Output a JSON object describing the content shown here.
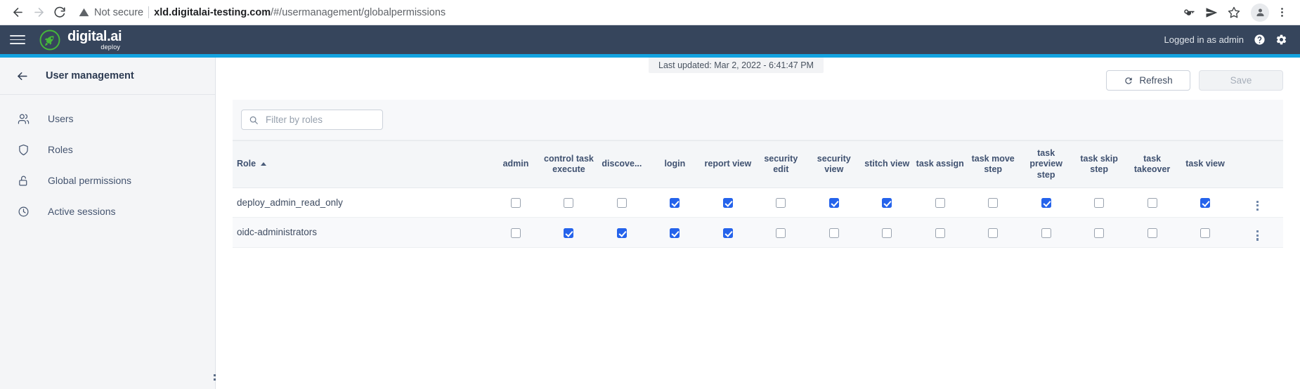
{
  "browser": {
    "back_icon": "back-arrow-icon",
    "forward_icon": "forward-arrow-icon",
    "reload_icon": "reload-icon",
    "security_icon": "warning-triangle-icon",
    "security_label": "Not secure",
    "url_host": "xld.digitalai-testing.com",
    "url_path": "/#/usermanagement/globalpermissions",
    "actions": [
      {
        "name": "password-key-icon"
      },
      {
        "name": "send-share-icon"
      },
      {
        "name": "bookmark-star-icon"
      },
      {
        "name": "profile-avatar-icon"
      },
      {
        "name": "browser-menu-icon"
      }
    ]
  },
  "app_header": {
    "menu_icon": "hamburger-menu-icon",
    "logo_icon": "rocket-logo-icon",
    "brand_name": "digital.ai",
    "brand_sub": "deploy",
    "logged_in_text": "Logged in as admin",
    "help_icon": "help-circle-icon",
    "settings_icon": "gear-icon",
    "background": "#36455c",
    "accent_color": "#13a3e0"
  },
  "sidebar": {
    "back_icon": "back-arrow-icon",
    "title": "User management",
    "items": [
      {
        "label": "Users",
        "icon": "people-icon"
      },
      {
        "label": "Roles",
        "icon": "shield-icon"
      },
      {
        "label": "Global permissions",
        "icon": "unlock-icon"
      },
      {
        "label": "Active sessions",
        "icon": "clock-icon"
      }
    ],
    "resize_handle": "sidebar-resize-handle"
  },
  "toolbar": {
    "last_updated": "Last updated: Mar 2, 2022 - 6:41:47 PM",
    "refresh_label": "Refresh",
    "refresh_icon": "refresh-icon",
    "save_label": "Save",
    "save_disabled": true
  },
  "filter": {
    "placeholder": "Filter by roles",
    "value": "",
    "icon": "search-icon"
  },
  "table": {
    "role_column_label": "Role",
    "sort_direction": "asc",
    "columns": [
      "admin",
      "control task execute",
      "discove...",
      "login",
      "report view",
      "security edit",
      "security view",
      "stitch view",
      "task assign",
      "task move step",
      "task preview step",
      "task skip step",
      "task takeover",
      "task view"
    ],
    "rows": [
      {
        "role": "deploy_admin_read_only",
        "permissions": [
          false,
          false,
          false,
          true,
          true,
          false,
          true,
          true,
          false,
          false,
          true,
          false,
          false,
          true
        ],
        "menu_icon": "row-menu-icon"
      },
      {
        "role": "oidc-administrators",
        "permissions": [
          false,
          true,
          true,
          true,
          true,
          false,
          false,
          false,
          false,
          false,
          false,
          false,
          false,
          false
        ],
        "menu_icon": "row-menu-icon"
      }
    ]
  },
  "colors": {
    "checkbox_checked": "#2563eb",
    "header_bg": "#36455c",
    "accent": "#13a3e0"
  }
}
